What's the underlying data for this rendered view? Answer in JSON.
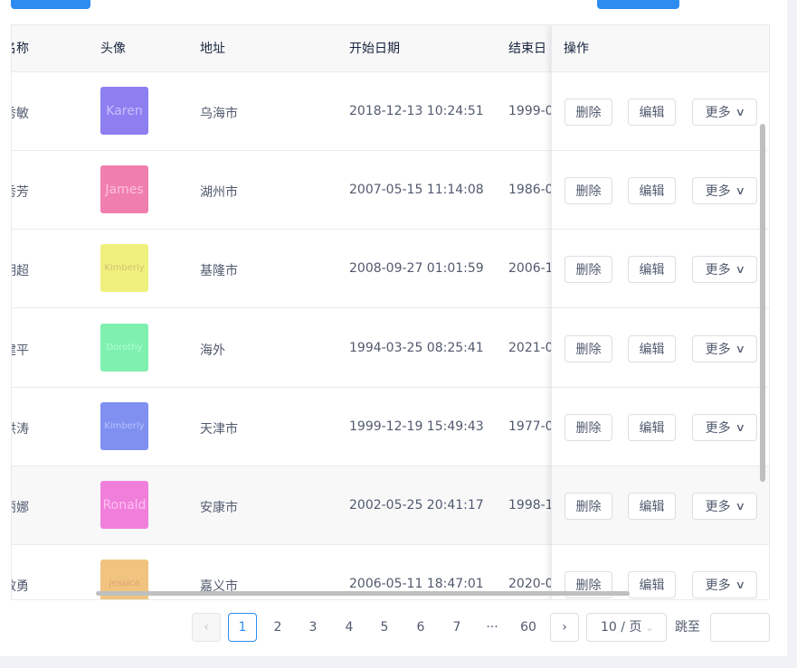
{
  "table": {
    "headers": {
      "name": "名称",
      "avatar": "头像",
      "address": "地址",
      "start_date": "开始日期",
      "end_date": "结束日",
      "actions": "操作"
    },
    "rows": [
      {
        "name": "秀敏",
        "avatar": {
          "text": "Karen",
          "color": "#8d7ff0",
          "text_color": "#c8c0ff"
        },
        "address": "乌海市",
        "start": "2018-12-13 10:24:51",
        "end": "1999-0"
      },
      {
        "name": "秀芳",
        "avatar": {
          "text": "James",
          "color": "#f07fb0",
          "text_color": "#ffc0dc"
        },
        "address": "湖州市",
        "start": "2007-05-15 11:14:08",
        "end": "1986-0"
      },
      {
        "name": "明超",
        "avatar": {
          "text": "Kimberly",
          "color": "#f0f07f",
          "text_color": "#d4c070"
        },
        "address": "基隆市",
        "start": "2008-09-27 01:01:59",
        "end": "2006-1"
      },
      {
        "name": "建平",
        "avatar": {
          "text": "Dorothy",
          "color": "#7ff0b0",
          "text_color": "#b0ffd0"
        },
        "address": "海外",
        "start": "1994-03-25 08:25:41",
        "end": "2021-0"
      },
      {
        "name": "洪涛",
        "avatar": {
          "text": "Kimberly",
          "color": "#7f90f0",
          "text_color": "#b8c2ff"
        },
        "address": "天津市",
        "start": "1999-12-19 15:49:43",
        "end": "1977-0"
      },
      {
        "name": "丽娜",
        "avatar": {
          "text": "Ronald",
          "color": "#f07fdc",
          "text_color": "#ffc0f0"
        },
        "address": "安康市",
        "start": "2002-05-25 20:41:17",
        "end": "1998-1"
      },
      {
        "name": "敏勇",
        "avatar": {
          "text": "Jessica",
          "color": "#f0c47f",
          "text_color": "#e0a070"
        },
        "address": "嘉义市",
        "start": "2006-05-11 18:47:01",
        "end": "2020-0"
      }
    ],
    "action_labels": {
      "delete": "删除",
      "edit": "编辑",
      "more": "更多"
    }
  },
  "pagination": {
    "pages": [
      "1",
      "2",
      "3",
      "4",
      "5",
      "6",
      "7",
      "···",
      "60"
    ],
    "current": "1",
    "page_size": "10 / 页",
    "jump_label": "跳至"
  },
  "colors": {
    "primary": "#2d8cf0"
  }
}
